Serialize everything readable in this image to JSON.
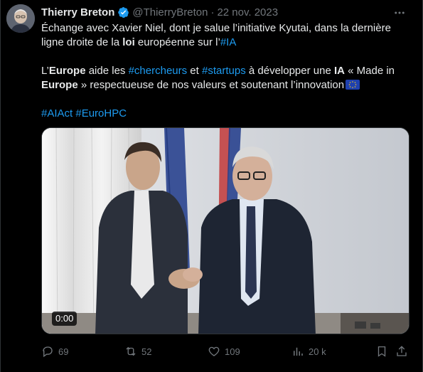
{
  "author": {
    "display_name": "Thierry Breton",
    "handle": "@ThierryBreton",
    "separator": "·",
    "date": "22 nov. 2023",
    "verified_icon": "verified-badge-icon"
  },
  "tweet": {
    "p1_a": "Échange avec Xavier Niel, dont je salue l’initiative Kyutai, dans la dernière ligne droite de la ",
    "p1_b": "loi",
    "p1_c": " européenne sur l’",
    "p1_d": "#IA",
    "p2_a": "L’",
    "p2_b": "Europe",
    "p2_c": " aide les ",
    "p2_d": "#chercheurs",
    "p2_e": " et ",
    "p2_f": "#startups",
    "p2_g": " à développer une ",
    "p2_h": "IA",
    "p2_i": " « Made in ",
    "p2_j": "Europe",
    "p2_k": " » respectueuse de nos valeurs et soutenant l’innovation",
    "p3_a": "#AIAct",
    "p3_b": " ",
    "p3_c": "#EuroHPC"
  },
  "media": {
    "timecode": "0:00"
  },
  "actions": {
    "replies": "69",
    "reposts": "52",
    "likes": "109",
    "views": "20 k"
  },
  "colors": {
    "background": "#000000",
    "text": "#e7e9ea",
    "muted": "#71767b",
    "link": "#1d9bf0"
  }
}
